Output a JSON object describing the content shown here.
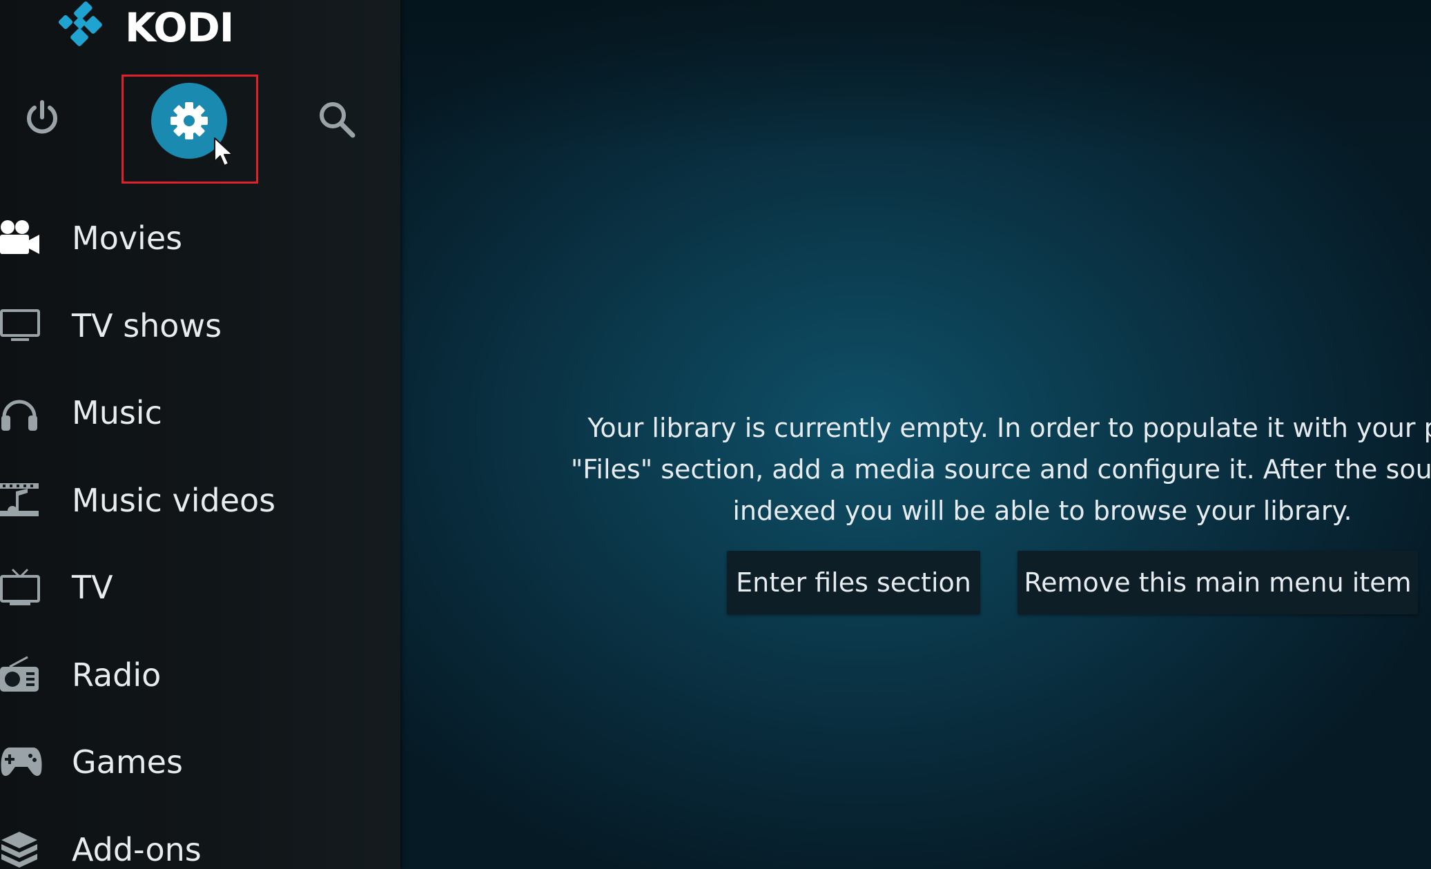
{
  "app": {
    "brand": "KODI"
  },
  "top_buttons": {
    "power": "power-icon",
    "settings": "gear-icon",
    "search": "search-icon"
  },
  "menu": {
    "items": [
      {
        "label": "Movies",
        "icon": "movie-camera-icon"
      },
      {
        "label": "TV shows",
        "icon": "tv-monitor-icon"
      },
      {
        "label": "Music",
        "icon": "headphones-icon"
      },
      {
        "label": "Music videos",
        "icon": "music-video-icon"
      },
      {
        "label": "TV",
        "icon": "tv-antenna-icon"
      },
      {
        "label": "Radio",
        "icon": "radio-icon"
      },
      {
        "label": "Games",
        "icon": "gamepad-icon"
      },
      {
        "label": "Add-ons",
        "icon": "addons-box-icon"
      }
    ]
  },
  "content": {
    "message": "Your library is currently empty. In order to populate it with your perso\n\"Files\" section, add a media source and configure it. After the source ha\nindexed you will be able to browse your library.",
    "buttons": {
      "enter_files": "Enter files section",
      "remove_item": "Remove this main menu item"
    }
  },
  "colors": {
    "accent": "#1a8ab0",
    "highlight_border": "#e0202a",
    "sidebar_bg": "#111619",
    "button_bg": "#0e1e26"
  }
}
